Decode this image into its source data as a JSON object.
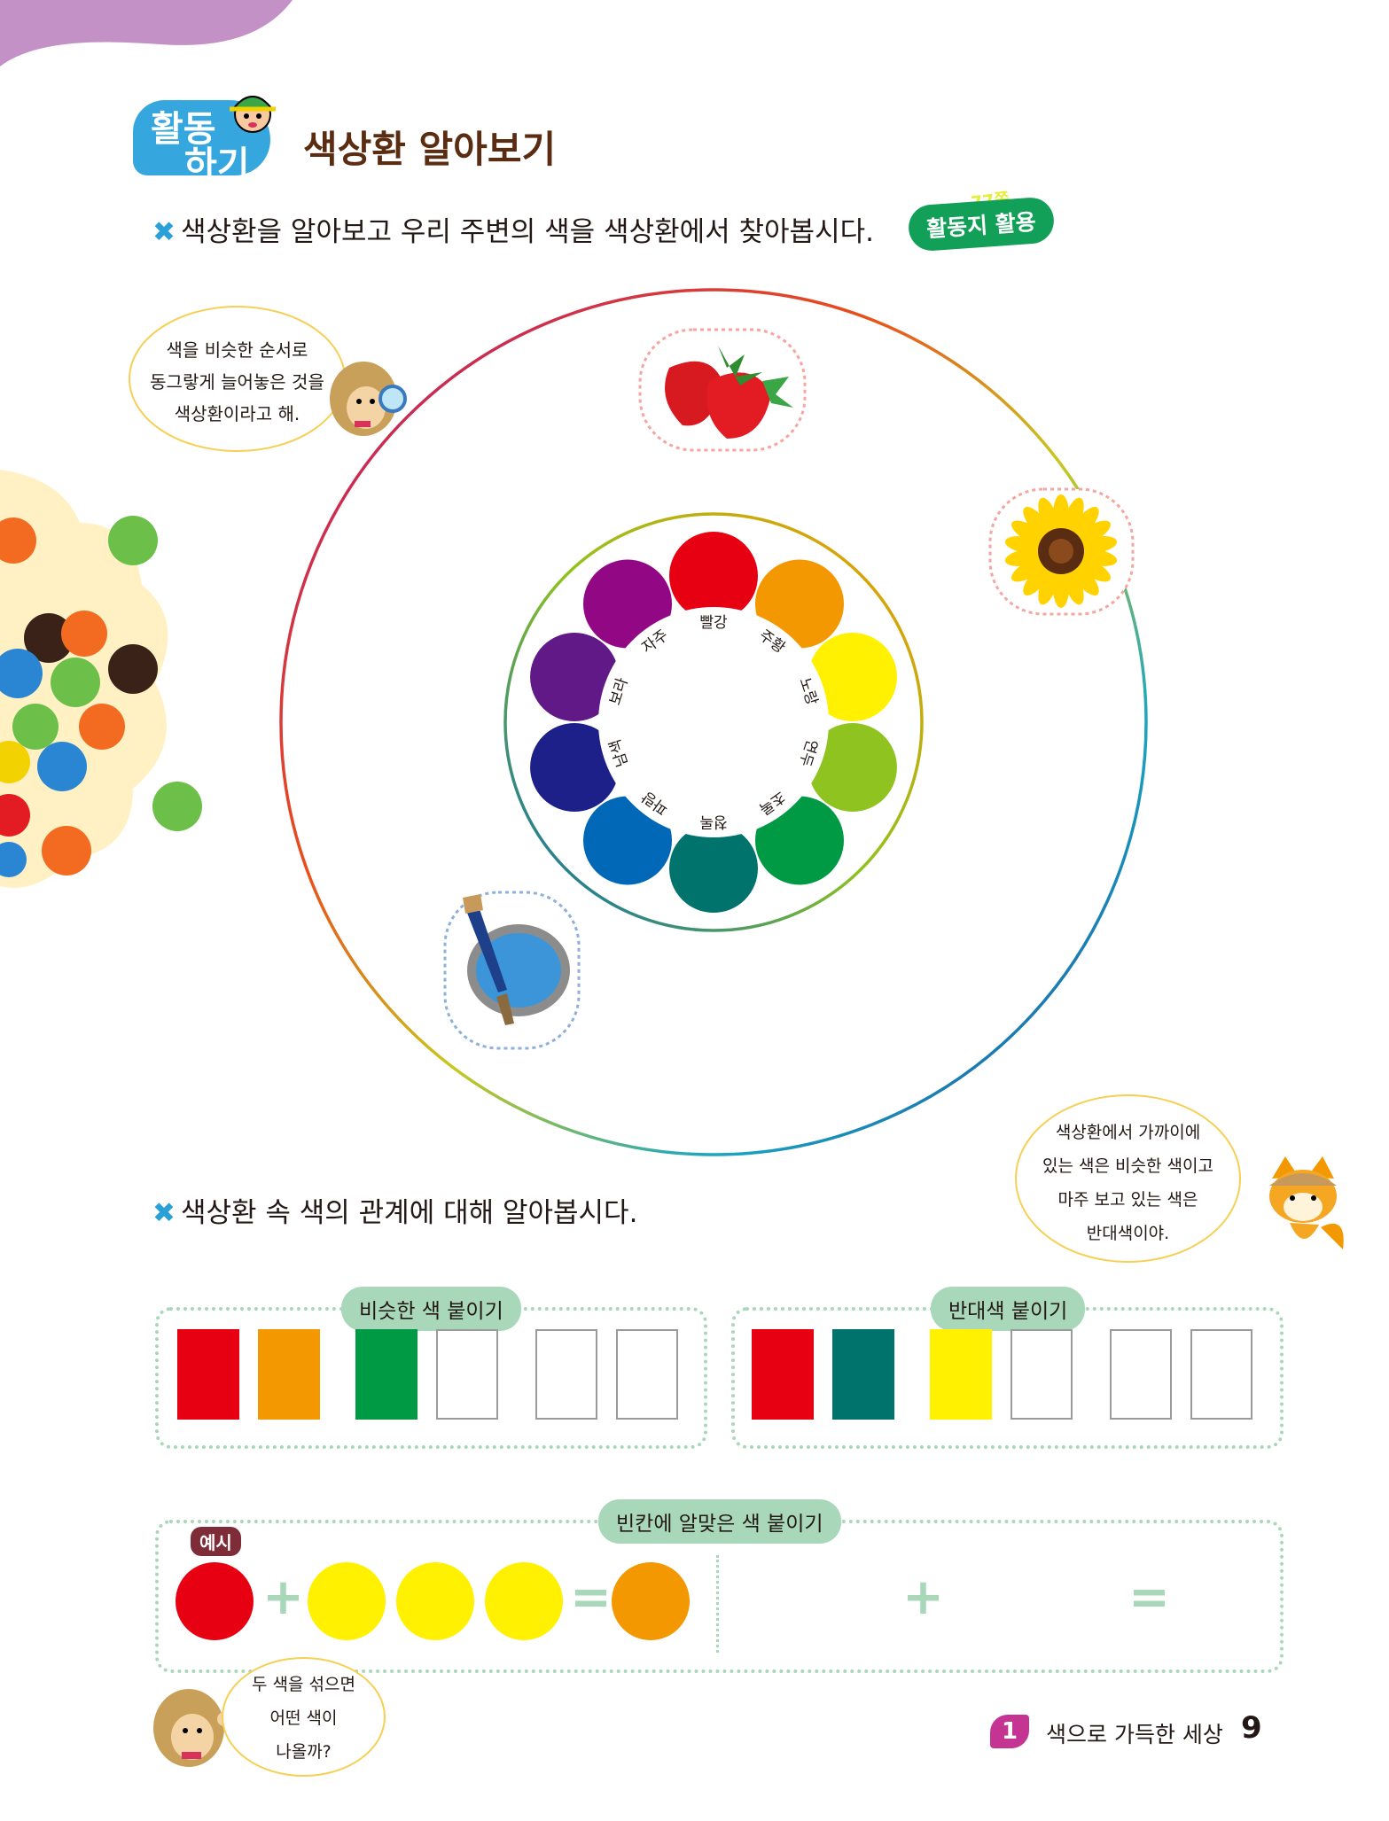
{
  "header": {
    "badge_line1": "활동",
    "badge_line2": "하기",
    "title": "색상환 알아보기"
  },
  "instruction1": "색상환을 알아보고 우리 주변의 색을 색상환에서 찾아봅시다.",
  "worksheet_tag": {
    "label": "활동지 활용",
    "page_note": "77쪽"
  },
  "hedgehog_bubble_top": [
    "색을 비슷한 순서로",
    "동그랗게 늘어놓은 것을",
    "색상환이라고 해."
  ],
  "color_wheel": {
    "petals": [
      {
        "label": "빨강",
        "color": "#e60012"
      },
      {
        "label": "주황",
        "color": "#f39800"
      },
      {
        "label": "노랑",
        "color": "#fff100"
      },
      {
        "label": "연두",
        "color": "#8fc31f"
      },
      {
        "label": "초록",
        "color": "#009944"
      },
      {
        "label": "청록",
        "color": "#00736d"
      },
      {
        "label": "파랑",
        "color": "#0068b7"
      },
      {
        "label": "남색",
        "color": "#1d2088"
      },
      {
        "label": "보라",
        "color": "#601986"
      },
      {
        "label": "자주",
        "color": "#920783"
      }
    ]
  },
  "fox_bubble": [
    "색상환에서 가까이에",
    "있는 색은 비슷한 색이고",
    "마주 보고 있는 색은",
    "반대색이야."
  ],
  "instruction2": "색상환 속 색의 관계에 대해 알아봅시다.",
  "similar": {
    "label": "비슷한 색 붙이기",
    "filled": [
      "#e60012",
      "#f39800",
      "#009944"
    ]
  },
  "opposite": {
    "label": "반대색 붙이기",
    "filled": [
      "#e60012",
      "#00736d",
      "#fff100"
    ]
  },
  "mix": {
    "label": "빈칸에 알맞은 색 붙이기",
    "example_tag": "예시",
    "example_inputs": [
      "#e60012",
      "#fff100",
      "#fff100",
      "#fff100"
    ],
    "example_result": "#f39800",
    "plus_symbol": "+",
    "equals_symbol": "="
  },
  "hedgehog_bubble_bottom": [
    "두 색을 섞으면",
    "어떤 색이",
    "나올까?"
  ],
  "footer": {
    "chapter_no": "1",
    "chapter_title": "색으로 가득한 세상",
    "page_number": "9"
  }
}
